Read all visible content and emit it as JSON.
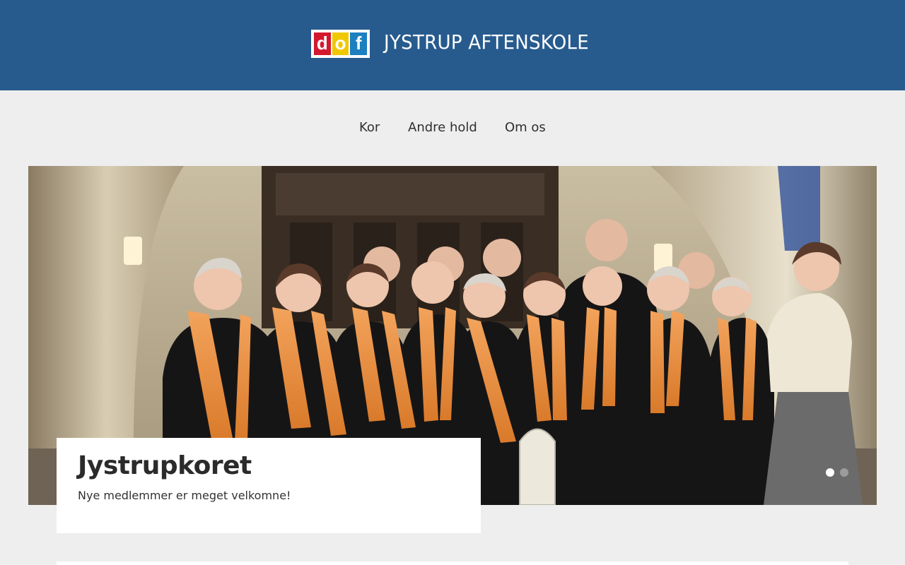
{
  "header": {
    "logo_letters": [
      "d",
      "o",
      "f"
    ],
    "site_title": "JYSTRUP AFTENSKOLE",
    "colors": {
      "background": "#275b8e",
      "logo_red": "#d4192f",
      "logo_yellow": "#f0c800",
      "logo_blue": "#1b7fc0"
    }
  },
  "nav": {
    "items": [
      {
        "label": "Kor"
      },
      {
        "label": "Andre hold"
      },
      {
        "label": "Om os"
      }
    ]
  },
  "slider": {
    "image_alt": "choir-photo",
    "caption_title": "Jystrupkoret",
    "caption_text": "Nye medlemmer er meget velkomne!",
    "slide_count": 2,
    "active_slide": 1
  }
}
